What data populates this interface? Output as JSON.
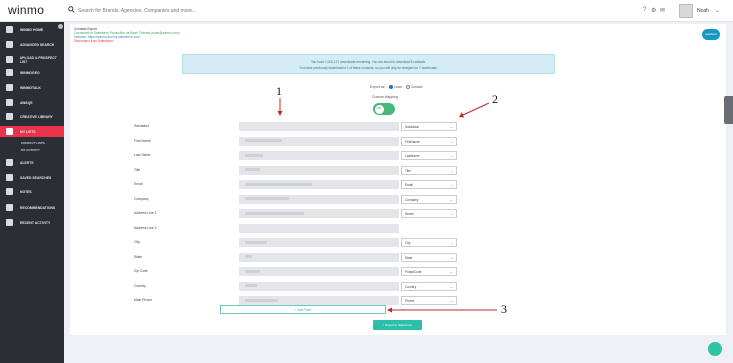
{
  "topbar": {
    "logo": "winmo",
    "search_placeholder": "Search for Brands, Agencies, Companies and more...",
    "icons": [
      "help-icon",
      "settings-icon",
      "mail-icon"
    ],
    "user_name": "Noah"
  },
  "sidebar": {
    "items": [
      {
        "label": "WINMO HOME",
        "icon": "home-icon"
      },
      {
        "label": "ADVANCED SEARCH",
        "icon": "search-icon"
      },
      {
        "label": "UPLOAD A PROSPECT LIST",
        "icon": "upload-icon"
      },
      {
        "label": "WINMOGEO",
        "icon": "map-icon"
      },
      {
        "label": "WINMOTALK",
        "icon": "chat-icon"
      },
      {
        "label": "AWAQE",
        "icon": "file-icon"
      },
      {
        "label": "CREATIVE LIBRARY",
        "icon": "creative-icon"
      },
      {
        "label": "MY LISTS",
        "icon": "list-icon",
        "active": true
      },
      {
        "label": "ALERTS",
        "icon": "bell-icon"
      },
      {
        "label": "SAVED SEARCHES",
        "icon": "star-icon"
      },
      {
        "label": "NOTES",
        "icon": "pencil-icon"
      },
      {
        "label": "RECOMMENDATIONS",
        "icon": "doc-icon"
      },
      {
        "label": "RECENT ACTIVITY",
        "icon": "chart-icon"
      }
    ],
    "sub_items": [
      "CONTACT LISTS",
      "MY ACTIVITY"
    ]
  },
  "header_info": {
    "title": "Contacts Export",
    "connected": "Connected to Salesforce Production as Noah Thomas (noah@winmo.com)",
    "instance": "Instance: https://winmo.dev.my.salesforce.com",
    "disconnect": "Disconnect from Salesforce"
  },
  "banner": {
    "line1": "You have 1,000,127 downloads remaining. You are about to download 8 contacts.",
    "line2": "You have previously downloaded 1 of these contacts, so you will only be charged for 7 downloads."
  },
  "salesforce_badge": "salesforce",
  "export_as": {
    "label": "Export as:",
    "options": [
      "Lead",
      "Contact"
    ],
    "selected": "Lead"
  },
  "custom_mapping": {
    "label": "Custom Mapping",
    "state": "ON"
  },
  "fields": [
    {
      "label": "Salutation",
      "mapping": "Salutation",
      "value_width": 0
    },
    {
      "label": "First Name",
      "mapping": "FirstName",
      "value_width": 0.25
    },
    {
      "label": "Last Name",
      "mapping": "LastName",
      "value_width": 0.12
    },
    {
      "label": "Title",
      "mapping": "Title",
      "value_width": 0.1
    },
    {
      "label": "Email",
      "mapping": "Email",
      "value_width": 0.45
    },
    {
      "label": "Company",
      "mapping": "Company",
      "value_width": 0.3
    },
    {
      "label": "Address Line 1",
      "mapping": "Street",
      "value_width": 0.4
    },
    {
      "label": "Address Line 2",
      "mapping": "",
      "value_width": 0
    },
    {
      "label": "City",
      "mapping": "City",
      "value_width": 0.15
    },
    {
      "label": "State",
      "mapping": "State",
      "value_width": 0.05
    },
    {
      "label": "Zip Code",
      "mapping": "PostalCode",
      "value_width": 0.1
    },
    {
      "label": "Country",
      "mapping": "Country",
      "value_width": 0.08
    },
    {
      "label": "Main Phone",
      "mapping": "Phone",
      "value_width": 0.22
    }
  ],
  "add_field_label": "+ Add Field",
  "export_button_label": "↑ Export to Salesforce",
  "annotations": [
    "1",
    "2",
    "3"
  ],
  "colors": {
    "accent_red": "#e8334a",
    "teal": "#2dbfa8",
    "toggle_green": "#49b87a"
  }
}
